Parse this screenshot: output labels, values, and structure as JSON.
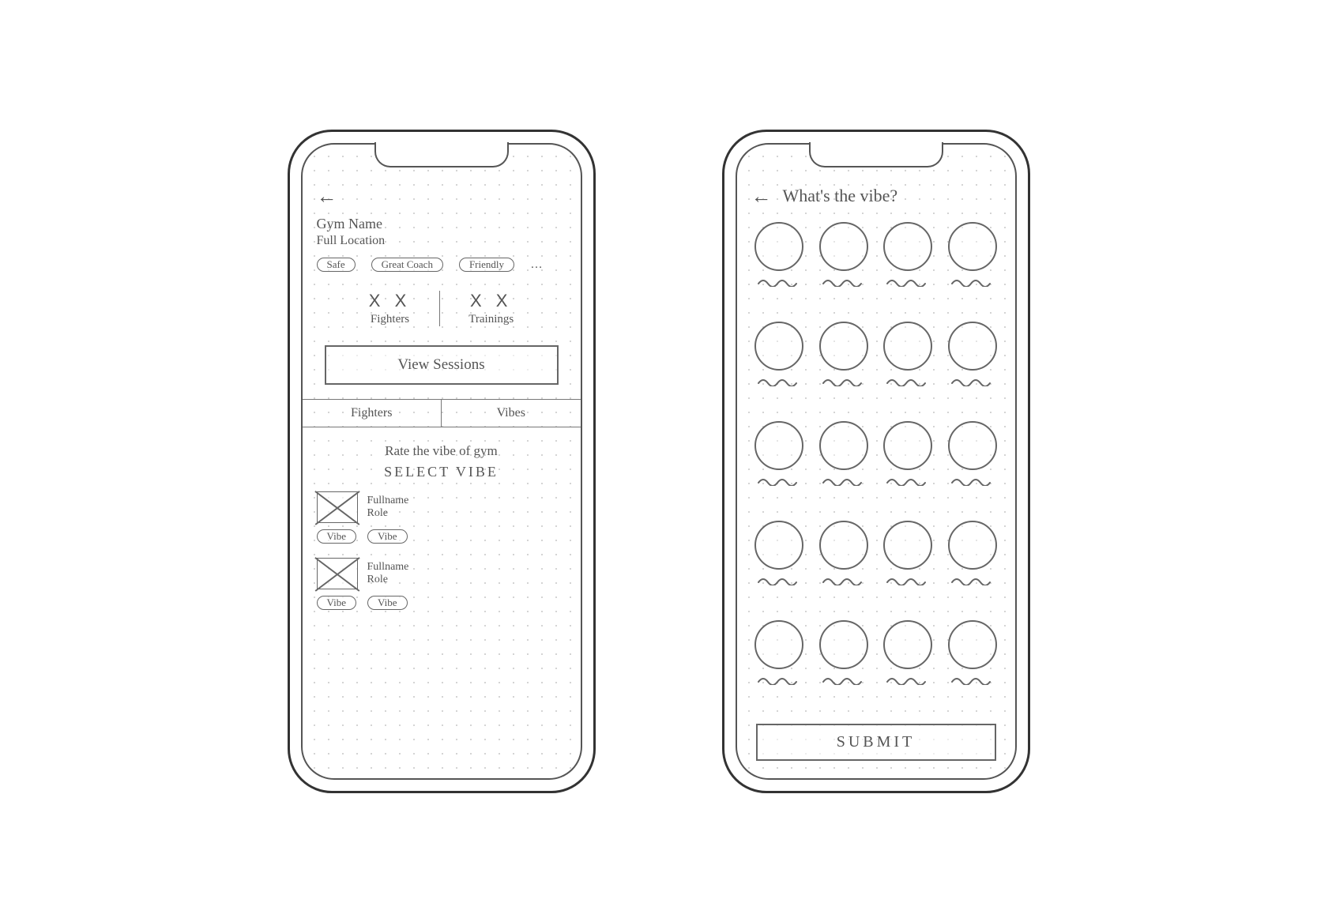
{
  "screen1": {
    "gym_name": "Gym Name",
    "location": "Full Location",
    "tags": [
      "Safe",
      "Great Coach",
      "Friendly"
    ],
    "more_indicator": "…",
    "stats": {
      "fighters": {
        "value": "X X",
        "label": "Fighters"
      },
      "trainings": {
        "value": "X X",
        "label": "Trainings"
      }
    },
    "view_sessions": "View Sessions",
    "tabs": {
      "fighters": "Fighters",
      "vibes": "Vibes"
    },
    "rate_prompt": "Rate the vibe of gym",
    "select_vibe": "SELECT  VIBE",
    "reviews": [
      {
        "fullname": "Fullname",
        "role": "Role",
        "vibes": [
          "Vibe",
          "Vibe"
        ]
      },
      {
        "fullname": "Fullname",
        "role": "Role",
        "vibes": [
          "Vibe",
          "Vibe"
        ]
      }
    ]
  },
  "screen2": {
    "title": "What's the vibe?",
    "option_count": 20,
    "submit": "SUBMIT"
  }
}
